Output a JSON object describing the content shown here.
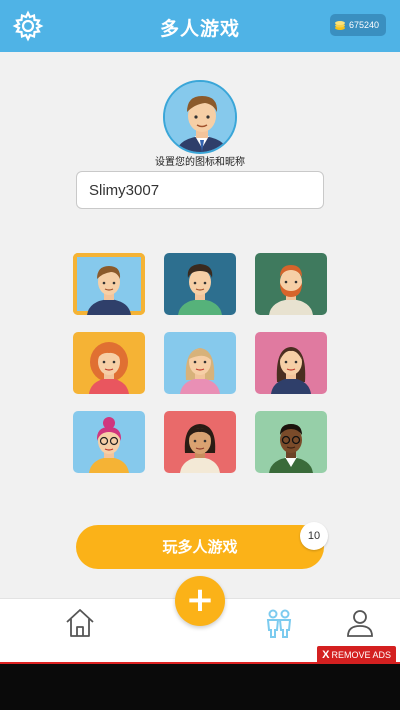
{
  "header": {
    "title": "多人游戏",
    "coins": "675240"
  },
  "profile": {
    "set_label": "设置您的图标和昵称",
    "nickname_value": "Slimy3007",
    "nickname_placeholder": ""
  },
  "avatars": [
    {
      "name": "avatar-man-brown-hair",
      "selected": true
    },
    {
      "name": "avatar-man-curly-hair"
    },
    {
      "name": "avatar-man-red-beard"
    },
    {
      "name": "avatar-woman-red-curly"
    },
    {
      "name": "avatar-woman-blonde"
    },
    {
      "name": "avatar-woman-brown-hair"
    },
    {
      "name": "avatar-woman-pink-hair-glasses"
    },
    {
      "name": "avatar-woman-dark-hair"
    },
    {
      "name": "avatar-man-glasses-dark-skin"
    }
  ],
  "play": {
    "label": "玩多人游戏",
    "badge": "10"
  },
  "nav": {
    "items": [
      "home-icon",
      "add-icon",
      "multiplayer-icon",
      "profile-icon"
    ],
    "active": "multiplayer-icon"
  },
  "ads": {
    "remove_x": "X",
    "remove_label": "REMOVE ADS"
  },
  "colors": {
    "header": "#4fb3e6",
    "accent": "#fbb218",
    "active_nav": "#7ccbef"
  }
}
